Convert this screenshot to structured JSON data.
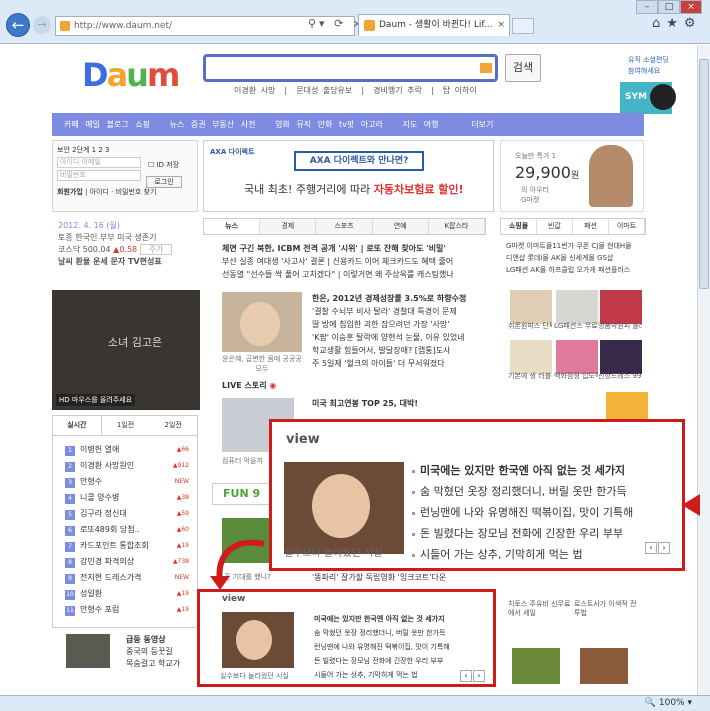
{
  "browser": {
    "url": "http://www.daum.net/",
    "tab_title": "Daum - 생활이 바뀐다! Lif...",
    "zoom": "100%",
    "nav_back_icon": "←",
    "nav_fwd_icon": "→",
    "tab_close": "×",
    "home_icon": "⌂",
    "star_icon": "★",
    "gear_icon": "⚙",
    "addr_icons": "⚲▾ ⟳ ×",
    "win_min": "–",
    "win_max": "□",
    "win_close": "×"
  },
  "header": {
    "logo": "Daum",
    "search_button": "검색",
    "hot_keywords": [
      "이경환 사망",
      "문대성 출당유보",
      "경비행기 추락",
      "탑 이하이"
    ],
    "corner_promo": "유직 소셜편딩 참여해세요",
    "sym_label": "SYM"
  },
  "gnb": {
    "items": [
      "카페",
      "메일",
      "블로그",
      "쇼핑",
      "뉴스",
      "증권",
      "부동산",
      "사전",
      "영화",
      "뮤직",
      "만화",
      "tv팟",
      "아고라",
      "지도",
      "여행",
      "더보기"
    ]
  },
  "login": {
    "security_label": "보안",
    "security_steps": "2단계 1 2 3",
    "id_placeholder": "아이디 이메일",
    "id_save": "ID 저장",
    "pw_placeholder": "비밀번호",
    "login_button": "로그인",
    "join_link": "회원가입",
    "find_link": "아이디 · 비밀번호 찾기"
  },
  "date_box": {
    "date": "2012. 4. 16 (월)",
    "headline": "토종 한국인 부부 미국 생존기",
    "kosdaq": "코스닥 500.04",
    "kosdaq_change": "0.58",
    "kosdaq_action": "주가",
    "links": "날씨 환율 운세 문자 TV편성표"
  },
  "now": {
    "title": "소녀 김고은",
    "caption": "HD 마우스를 올려주세요"
  },
  "rank": {
    "tabs": [
      "실시간",
      "1일전",
      "2일전"
    ],
    "items": [
      {
        "n": "1",
        "name": "이병헌 열애",
        "delta": "66"
      },
      {
        "n": "2",
        "name": "이경환 사망원인",
        "delta": "912"
      },
      {
        "n": "3",
        "name": "안형수",
        "delta": "NEW"
      },
      {
        "n": "4",
        "name": "니콜 양수병",
        "delta": "38"
      },
      {
        "n": "5",
        "name": "김구라 정신대",
        "delta": "59"
      },
      {
        "n": "6",
        "name": "로또489회 당첨..",
        "delta": "60"
      },
      {
        "n": "7",
        "name": "카드포인트 통합조회",
        "delta": "19"
      },
      {
        "n": "8",
        "name": "강민경 파격의상",
        "delta": "738"
      },
      {
        "n": "9",
        "name": "전지현 드레스가격",
        "delta": "NEW"
      },
      {
        "n": "10",
        "name": "성일환",
        "delta": "19"
      },
      {
        "n": "11",
        "name": "안형수 포럼",
        "delta": "19"
      }
    ]
  },
  "movie": {
    "title": "급등 동영상",
    "line1": "중국의 등꿋길",
    "line2": "목숨걸고 학교가"
  },
  "banner": {
    "tag": "AXA 다이렉트",
    "head": "AXA 다이렉트와 만나면?",
    "line_plain": "국내 최초! 주행거리에 따라",
    "line_bold": "자동차보험료 할인!"
  },
  "news": {
    "tabs": [
      "뉴스",
      "경제",
      "스포츠",
      "연예",
      "K팝스타"
    ],
    "top_lines": [
      "체면 구긴 북한, ICBM 전격 공개 '시위' | 로또 잔해 찾아도 '비밀'",
      "부산 실종 여대생 '사고사' 결론 | 신용카드 이어 체크카드도 혜택 줄어",
      "선동열 \"선수들 싹 풀어 고치겠다\" | 이렇거면 왜 주상옥를 캐스팅했나"
    ],
    "img_caption": "윤은혜, 곱변한 몸매 공공공 모두",
    "items": [
      "한은, 2012년 경제성장률 3.5%로 하향수정",
      "'결찰 수뇌부 비사 탈라' 경찰대 특경이 문제",
      "딸 방에 침입한 괴한 잡으려던 가장 '사망'",
      "'K팝' 이승훈 탈락에 양현석 눈물, 이유 있었네",
      "학교생활 힘들어서, 발달장애?  [캡통]도사",
      "주 5일제 '헐크의 아이들' 더 무서워졌다"
    ],
    "live_head": "LIVE 스토리",
    "live_title": "미국 최고연봉 TOP 25, 대박!",
    "live_caption": "컴퓨터 먹을까",
    "fun_label": "FUN 9",
    "fun_caption": "꽃 기대를 했니?",
    "last_line": "'똥파리' 잘가할 독립영화 '잉크코트'다운"
  },
  "today": {
    "label": "오늘만 특가 1",
    "price": "29,900",
    "shop": "의 아우터",
    "shop2": "G마켓"
  },
  "shopping": {
    "tabs": [
      "쇼핑몰",
      "빈값",
      "패션",
      "이마트"
    ],
    "ads": [
      "G마켓 이마트몰11번가 쿠폰 CJ몰 현대H몰",
      "디앤샵 롯데i몰 AK몰 신세계몰 GS샵",
      "LG패션 AK몰 하프클럽 오가게 패션플러스"
    ],
    "products": [
      {
        "label": "쉬폰원피스 단독런칭!"
      },
      {
        "label": "LG패션스 무료99%"
      },
      {
        "label": "명품악원피 블라우스"
      },
      {
        "label": "기본에 생 러블리터트"
      },
      {
        "label": "백화점정 입도적인가"
      },
      {
        "label": "신상드레스 9900원"
      },
      {
        "label": "치토스 주유비 신무료에서 세일"
      },
      {
        "label": "로스트사가 이색적 전투법"
      }
    ]
  },
  "view_big": {
    "logo": "view",
    "caption": "실수보다 놀라웠던 시실",
    "items": [
      "미국에는 있지만 한국엔 아직 없는 것 세가지",
      "숨 막혔던 옷장 정리했더니, 버릴 옷만 한가득",
      "런닝맨에 나와 유명해진 떡볶이집, 맛이 기특해",
      "돈 빌렸다는 장모님 전화에 긴장한 우리 부부",
      "시들어 가는 상추, 기막히게 먹는 법"
    ]
  },
  "view_small": {
    "logo": "view",
    "caption": "실수보다 놀라웠던 시실",
    "items": [
      "미국에는 있지만 한국엔 아직 없는 것 세가지",
      "숨 막혔던 옷장 정리했더니, 버릴 옷만 한가득",
      "런닝맨에 나와 유명해진 떡볶이집, 맛이 기특해",
      "돈 빌렸다는 장모님 전화에 긴장한 우리 부부",
      "시들어 가는 상추, 기막히게 먹는 법"
    ]
  },
  "colors": {
    "accent": "#7d8ce0",
    "callout": "#d01b1b",
    "logo_orange": "#f3a533"
  }
}
